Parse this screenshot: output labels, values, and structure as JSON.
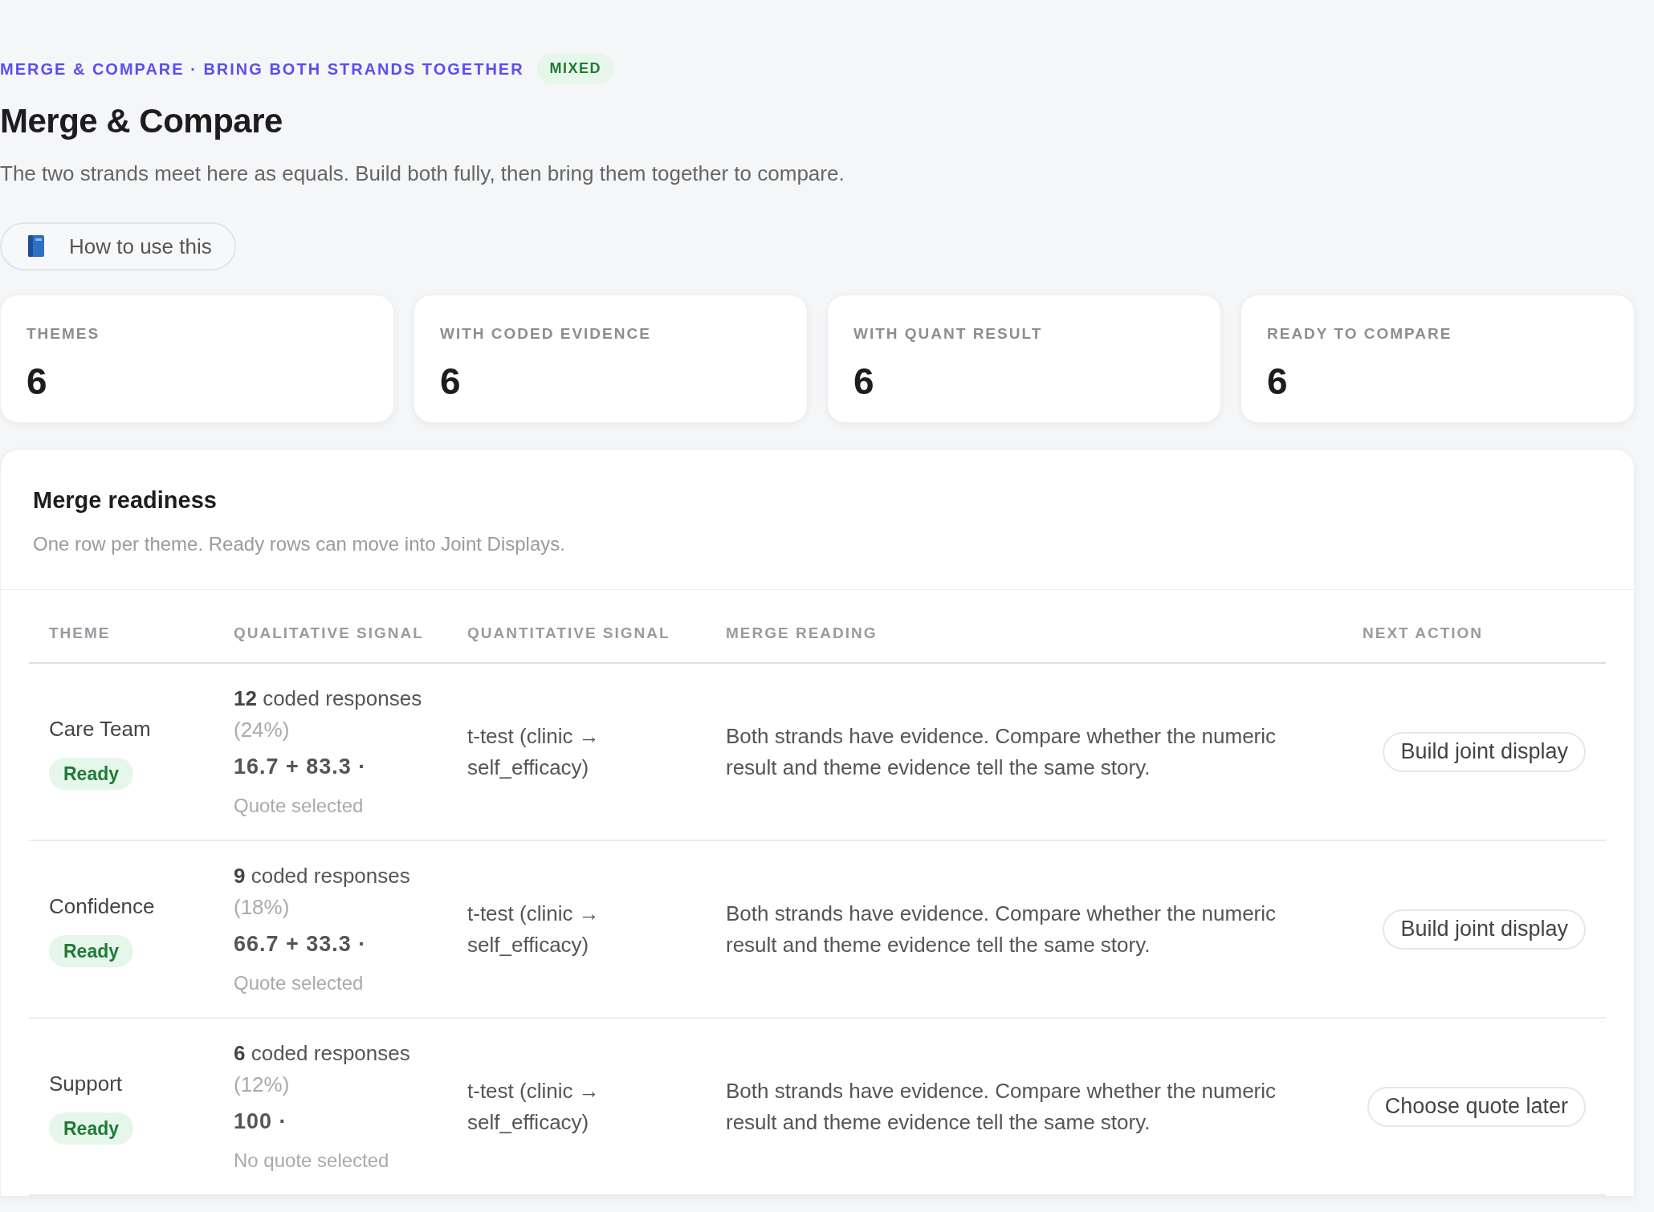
{
  "eyebrow": "MERGE & COMPARE · BRING BOTH STRANDS TOGETHER",
  "mode_badge": "MIXED",
  "title": "Merge & Compare",
  "description": "The two strands meet here as equals. Build both fully, then bring them together to compare.",
  "help_button": "How to use this",
  "stats": [
    {
      "label": "THEMES",
      "value": "6"
    },
    {
      "label": "WITH CODED EVIDENCE",
      "value": "6"
    },
    {
      "label": "WITH QUANT RESULT",
      "value": "6"
    },
    {
      "label": "READY TO COMPARE",
      "value": "6"
    }
  ],
  "panel": {
    "title": "Merge readiness",
    "subtitle": "One row per theme. Ready rows can move into Joint Displays.",
    "table": {
      "columns": [
        "THEME",
        "QUALITATIVE SIGNAL",
        "QUANTITATIVE SIGNAL",
        "MERGE READING",
        "NEXT ACTION"
      ],
      "rows": [
        {
          "theme": "Care Team",
          "status": "Ready",
          "coded_count": "12",
          "coded_label": "coded responses",
          "coded_share": "(24%)",
          "split": "16.7 + 83.3 ·",
          "quote": "Quote selected",
          "quant": "t-test (clinic → self_efficacy)",
          "reading": "Both strands have evidence. Compare whether the numeric result and theme evidence tell the same story.",
          "action": "Build joint display"
        },
        {
          "theme": "Confidence",
          "status": "Ready",
          "coded_count": "9",
          "coded_label": "coded responses",
          "coded_share": "(18%)",
          "split": "66.7 + 33.3 ·",
          "quote": "Quote selected",
          "quant": "t-test (clinic → self_efficacy)",
          "reading": "Both strands have evidence. Compare whether the numeric result and theme evidence tell the same story.",
          "action": "Build joint display"
        },
        {
          "theme": "Support",
          "status": "Ready",
          "coded_count": "6",
          "coded_label": "coded responses",
          "coded_share": "(12%)",
          "split": "100 ·",
          "quote": "No quote selected",
          "quant": "t-test (clinic → self_efficacy)",
          "reading": "Both strands have evidence. Compare whether the numeric result and theme evidence tell the same story.",
          "action": "Choose quote later"
        }
      ]
    }
  }
}
